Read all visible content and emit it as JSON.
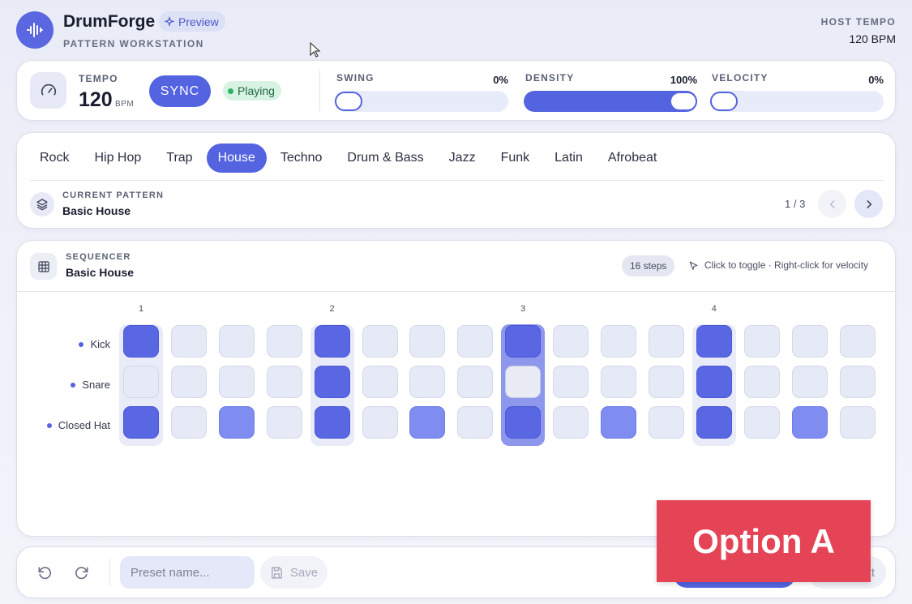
{
  "header": {
    "app_name": "DrumForge",
    "badge": "Preview",
    "subtitle": "PATTERN WORKSTATION",
    "host_tempo_label": "HOST TEMPO",
    "host_tempo_value": "120 BPM"
  },
  "transport": {
    "tempo_label": "TEMPO",
    "tempo_value": "120",
    "tempo_unit": "BPM",
    "sync_label": "SYNC",
    "status": "Playing",
    "sliders": [
      {
        "label": "SWING",
        "value_text": "0%",
        "value": 0
      },
      {
        "label": "DENSITY",
        "value_text": "100%",
        "value": 100
      },
      {
        "label": "VELOCITY",
        "value_text": "0%",
        "value": 0
      }
    ]
  },
  "genres": {
    "items": [
      "Rock",
      "Hip Hop",
      "Trap",
      "House",
      "Techno",
      "Drum & Bass",
      "Jazz",
      "Funk",
      "Latin",
      "Afrobeat"
    ],
    "active": "House"
  },
  "current_pattern": {
    "label": "CURRENT PATTERN",
    "name": "Basic House",
    "page": "1 / 3"
  },
  "sequencer": {
    "label": "SEQUENCER",
    "name": "Basic House",
    "steps_badge": "16 steps",
    "hint": "Click to toggle · Right-click for velocity",
    "beat_numbers": [
      "1",
      "2",
      "3",
      "4"
    ],
    "current_step": 9,
    "rows": [
      {
        "name": "Kick",
        "steps": [
          2,
          0,
          0,
          0,
          2,
          0,
          0,
          0,
          2,
          0,
          0,
          0,
          2,
          0,
          0,
          0
        ]
      },
      {
        "name": "Snare",
        "steps": [
          0,
          0,
          0,
          0,
          2,
          0,
          0,
          0,
          0,
          0,
          0,
          0,
          2,
          0,
          0,
          0
        ]
      },
      {
        "name": "Closed Hat",
        "steps": [
          2,
          0,
          1,
          0,
          2,
          0,
          1,
          0,
          2,
          0,
          1,
          0,
          2,
          0,
          1,
          0
        ]
      }
    ],
    "legend": {
      "0": "off",
      "1": "accent-medium",
      "2": "on"
    }
  },
  "footer": {
    "preset_placeholder": "Preset name...",
    "save_label": "Save",
    "partial_button_text": "t"
  },
  "overlay": {
    "text": "Option A"
  },
  "colors": {
    "accent": "#5463e0",
    "overlay": "#e54457",
    "playing_bg": "#d8f2e3"
  }
}
